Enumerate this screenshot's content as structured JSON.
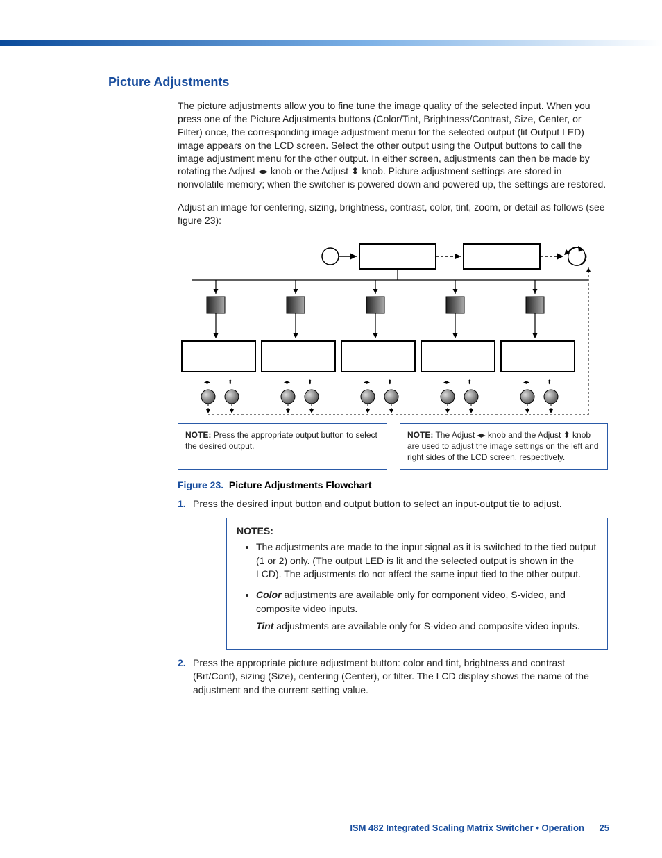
{
  "heading": "Picture Adjustments",
  "para1": "The picture adjustments allow you to fine tune the image quality of the selected input.  When you press one of the Picture Adjustments buttons (Color/Tint, Brightness/Contrast, Size, Center, or Filter) once, the corresponding image adjustment menu for the selected output (lit Output LED) image appears on the LCD screen.  Select the other output using the Output buttons to call the image adjustment menu for the other output.  In either screen, adjustments can then be made by rotating the Adjust ◂▸ knob or the Adjust ⬍ knob.  Picture adjustment settings are stored in nonvolatile memory; when the switcher is powered down and powered up, the settings are restored.",
  "para2": "Adjust an image for centering, sizing, brightness, contrast, color, tint, zoom, or detail as follows (see figure 23):",
  "note1_label": "NOTE:",
  "note1_text": "Press the appropriate output button to select the desired output.",
  "note2_label": "NOTE:",
  "note2_text": "The Adjust ◂▸ knob and the Adjust ⬍ knob are used to adjust the image settings on the left and right sides of the LCD screen, respectively.",
  "fig_num": "Figure 23.",
  "fig_title": "Picture Adjustments Flowchart",
  "step1_num": "1.",
  "step1_text": "Press the desired input button and output button to select an input-output tie to adjust.",
  "notes_title": "NOTES:",
  "notes_b1": "The adjustments are made to the input signal as it is switched to the tied output (1 or 2) only.  (The output LED is lit and the selected output is shown in the LCD).  The adjustments do not affect the same input tied to the other output.",
  "notes_b2_pre": "Color",
  "notes_b2_post": " adjustments are available only for component video, S-video, and composite video inputs.",
  "notes_b2_sub_pre": "Tint",
  "notes_b2_sub_post": " adjustments are available only for S-video and composite video inputs.",
  "step2_num": "2.",
  "step2_text": "Press the appropriate picture adjustment button: color and tint, brightness and contrast (Brt/Cont), sizing (Size), centering (Center), or filter.  The LCD display shows the name of the adjustment and the current setting value.",
  "footer_title": "ISM 482 Integrated Scaling Matrix Switcher • Operation",
  "footer_page": "25"
}
